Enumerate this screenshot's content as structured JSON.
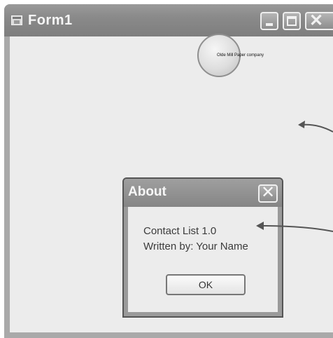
{
  "form": {
    "title": "Form1",
    "logo_text": "Olde Mill Paper company"
  },
  "about_dialog": {
    "title": "About",
    "close_glyph": "✕",
    "product_line": "Contact List 1.0",
    "author_line": "Written by:  Your Name",
    "ok_label": "OK"
  },
  "icons": {
    "app": "form-app-icon",
    "minimize": "minimize-icon",
    "maximize": "maximize-icon",
    "close": "close-icon"
  }
}
